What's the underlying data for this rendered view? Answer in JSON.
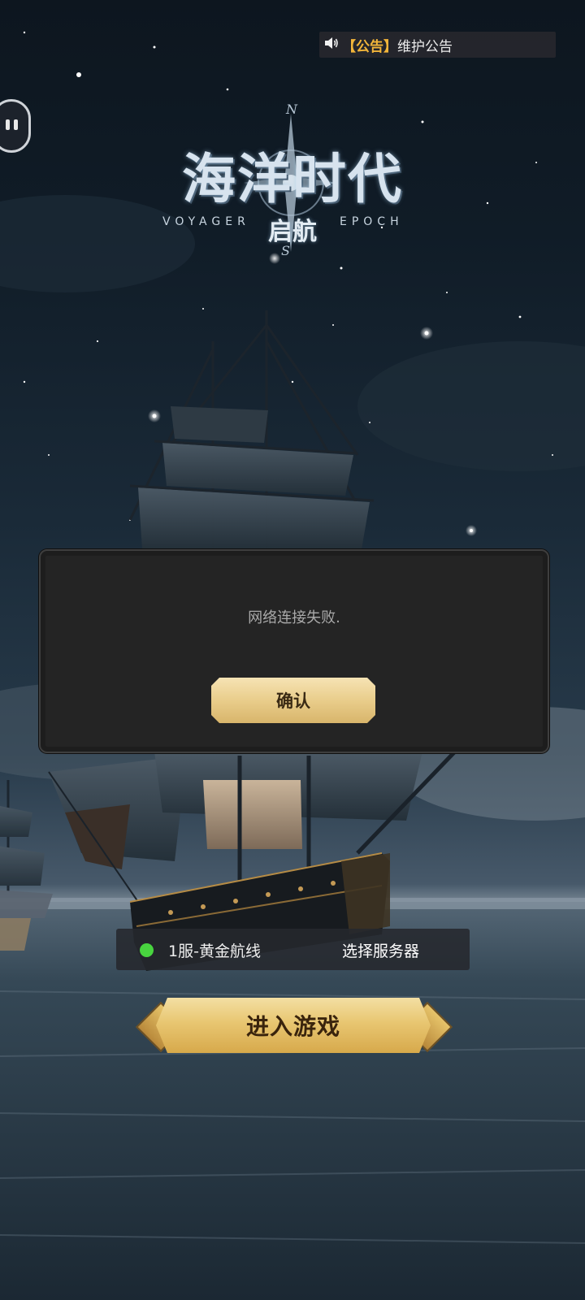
{
  "announcement": {
    "icon": "speaker-icon",
    "tag": "【公告】",
    "text": "维护公告"
  },
  "logo": {
    "title": "海洋时代",
    "subtitle": "启航",
    "left_text": "VOYAGER",
    "right_text": "EPOCH",
    "compass_north": "N",
    "compass_south": "S"
  },
  "dialog": {
    "message": "网络连接失败.",
    "confirm_label": "确认"
  },
  "server": {
    "status_color": "#48d43f",
    "name": "1服-黄金航线",
    "select_label": "选择服务器"
  },
  "enter_button": {
    "label": "进入游戏"
  },
  "colors": {
    "gold": "#e8c671",
    "notice_tag": "#f2b53a"
  }
}
